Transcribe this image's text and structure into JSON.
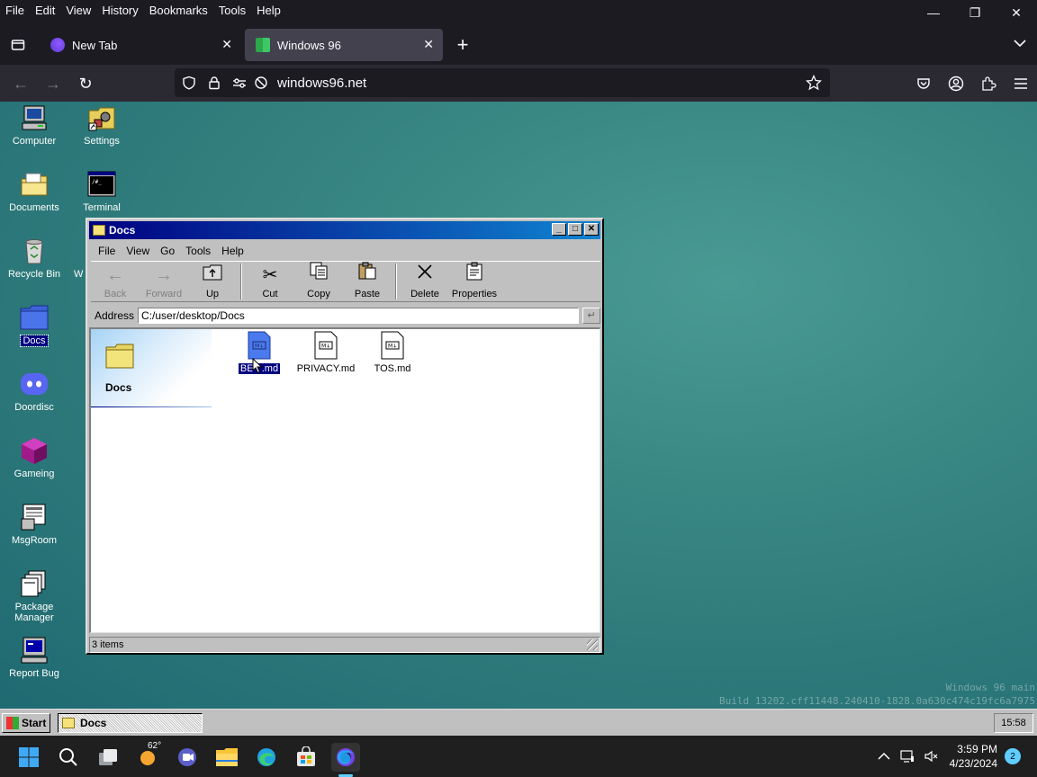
{
  "firefox": {
    "menu": [
      "File",
      "Edit",
      "View",
      "History",
      "Bookmarks",
      "Tools",
      "Help"
    ],
    "tabs": [
      {
        "label": "New Tab",
        "close": "✕"
      },
      {
        "label": "Windows 96",
        "close": "✕"
      }
    ],
    "url": "windows96.net",
    "colors": {
      "chrome": "#1c1b22",
      "toolbar": "#2b2a33",
      "active_tab": "#42414d"
    }
  },
  "desktop": {
    "icons": [
      {
        "label": "Computer",
        "icon": "computer-icon"
      },
      {
        "label": "Settings",
        "icon": "settings-icon"
      },
      {
        "label": "Documents",
        "icon": "documents-folder-icon"
      },
      {
        "label": "Terminal",
        "icon": "terminal-icon"
      },
      {
        "label": "Recycle Bin",
        "icon": "recycle-bin-icon"
      },
      {
        "label": "Docs",
        "icon": "folder-icon"
      },
      {
        "label": "Doordisc",
        "icon": "doordisc-icon"
      },
      {
        "label": "Gameing",
        "icon": "game-icon"
      },
      {
        "label": "MsgRoom",
        "icon": "msgroom-icon"
      },
      {
        "label": "Package Manager",
        "icon": "package-manager-icon"
      },
      {
        "label": "Report Bug",
        "icon": "report-bug-icon"
      }
    ],
    "partial_label": "W",
    "build_line1": "Windows 96 main",
    "build_line2": "Build 13202.cff11448.240410-1828.0a630c474c19fc6a7975"
  },
  "explorer": {
    "title": "Docs",
    "menu": [
      "File",
      "View",
      "Go",
      "Tools",
      "Help"
    ],
    "toolbar": {
      "back": "Back",
      "forward": "Forward",
      "up": "Up",
      "cut": "Cut",
      "copy": "Copy",
      "paste": "Paste",
      "delete": "Delete",
      "properties": "Properties"
    },
    "address_label": "Address",
    "address_value": "C:/user/desktop/Docs",
    "side_title": "Docs",
    "files": [
      {
        "label": "BE   .md",
        "selected": true
      },
      {
        "label": "PRIVACY.md",
        "selected": false
      },
      {
        "label": "TOS.md",
        "selected": false
      }
    ],
    "status": "3 items",
    "colors": {
      "title_start": "#000080",
      "title_end": "#1084d0",
      "face": "#c0c0c0"
    }
  },
  "taskbar96": {
    "start": "Start",
    "task": "Docs",
    "clock": "15:58"
  },
  "taskbar11": {
    "weather": "62°",
    "time": "3:59 PM",
    "date": "4/23/2024",
    "notifications": "2"
  }
}
